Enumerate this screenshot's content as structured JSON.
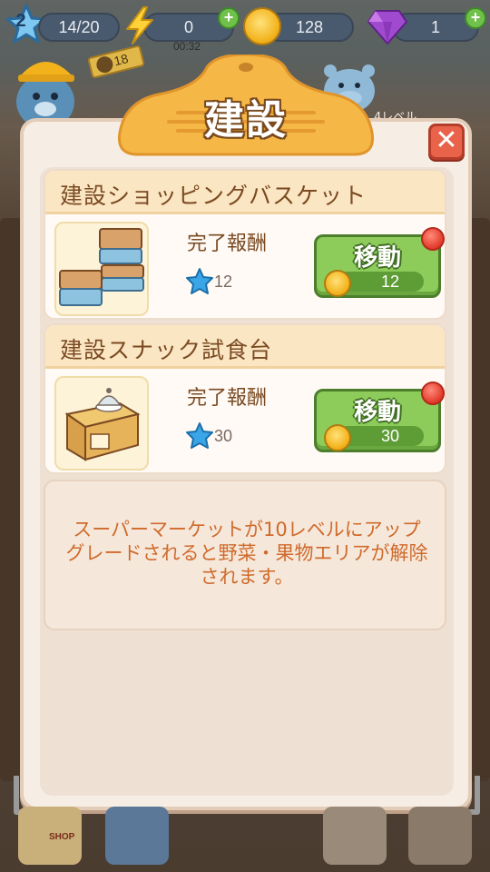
{
  "hud": {
    "level": "2",
    "xp": "14/20",
    "energy": "0",
    "timer": "00:32",
    "coins": "128",
    "gems": "1",
    "plus_symbol": "+"
  },
  "background": {
    "badge_count": "18",
    "level_label": "4レベル",
    "shop_label": "SHOP"
  },
  "dialog": {
    "title": "建設",
    "close_symbol": "✕",
    "tasks": [
      {
        "name": "建設ショッピングバスケット",
        "reward_label": "完了報酬",
        "reward_stars": "12",
        "button_label": "移動",
        "cost": "12"
      },
      {
        "name": "建設スナック試食台",
        "reward_label": "完了報酬",
        "reward_stars": "30",
        "button_label": "移動",
        "cost": "30"
      }
    ],
    "info_text": "スーパーマーケットが10レベルにアップグレードされると野菜・果物エリアが解除されます。"
  },
  "colors": {
    "accent_green": "#8dcc5a",
    "title_orange": "#f5b746",
    "info_orange": "#d06a2c",
    "close_red": "#e9634a"
  }
}
